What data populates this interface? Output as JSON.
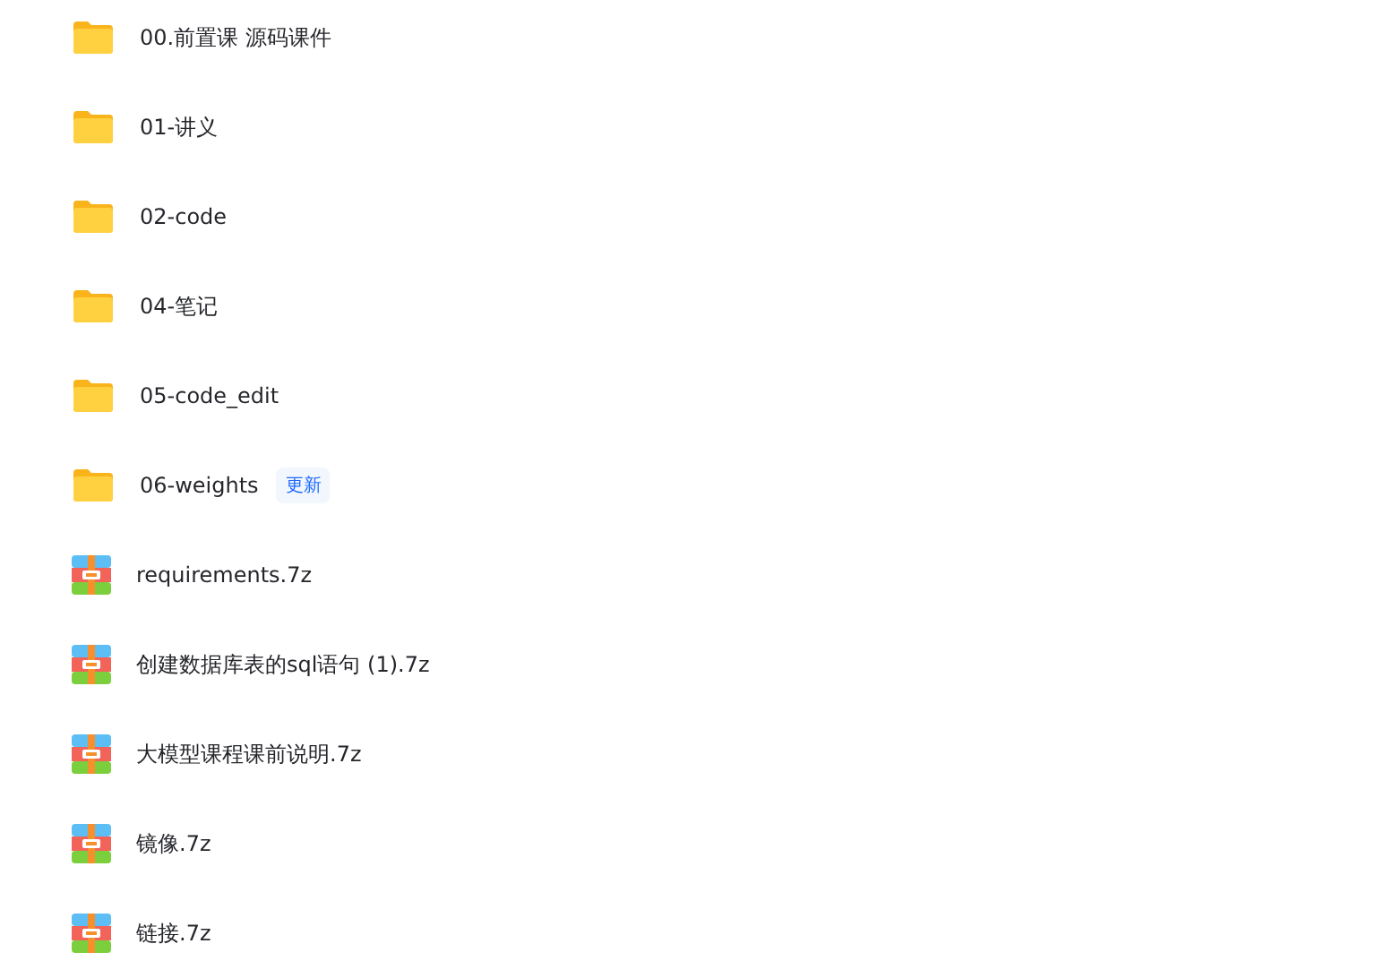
{
  "files": [
    {
      "kind": "folder",
      "name": "00.前置课 源码课件"
    },
    {
      "kind": "folder",
      "name": "01-讲义"
    },
    {
      "kind": "folder",
      "name": "02-code"
    },
    {
      "kind": "folder",
      "name": "04-笔记"
    },
    {
      "kind": "folder",
      "name": "05-code_edit"
    },
    {
      "kind": "folder",
      "name": "06-weights",
      "badge": "更新"
    },
    {
      "kind": "archive",
      "name": "requirements.7z"
    },
    {
      "kind": "archive",
      "name": "创建数据库表的sql语句 (1).7z"
    },
    {
      "kind": "archive",
      "name": "大模型课程课前说明.7z"
    },
    {
      "kind": "archive",
      "name": "镜像.7z"
    },
    {
      "kind": "archive",
      "name": "链接.7z"
    }
  ]
}
